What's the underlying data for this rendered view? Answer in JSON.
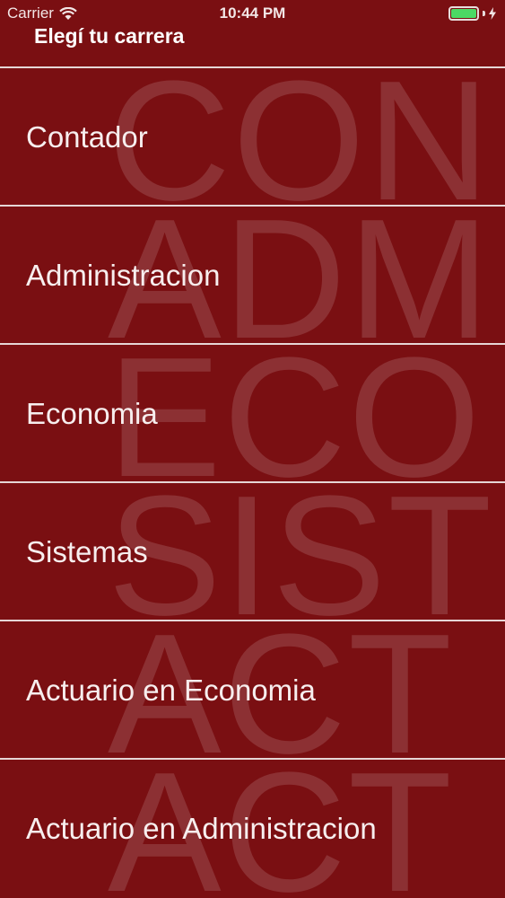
{
  "status_bar": {
    "carrier": "Carrier",
    "time": "10:44 PM"
  },
  "header": {
    "title": "Elegí tu carrera"
  },
  "careers": [
    {
      "label": "Contador",
      "watermark": "CON"
    },
    {
      "label": "Administracion",
      "watermark": "ADM"
    },
    {
      "label": "Economia",
      "watermark": "ECO"
    },
    {
      "label": "Sistemas",
      "watermark": "SIST"
    },
    {
      "label": "Actuario en Economia",
      "watermark": "ACT"
    },
    {
      "label": "Actuario en Administracion",
      "watermark": "ACT"
    }
  ],
  "colors": {
    "background": "#7a0f12",
    "battery": "#4cd964"
  }
}
